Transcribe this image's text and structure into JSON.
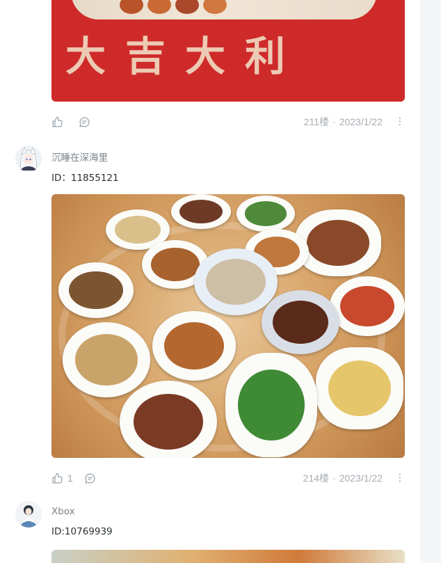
{
  "posts": [
    {
      "image_desc": "red-banner-photo",
      "image_slogan": "大吉大利",
      "like_count": "",
      "floor": "211楼",
      "date": "2023/1/22",
      "more": "⋮"
    },
    {
      "author": "沉睡在深海里",
      "author_id": "ID：11855121",
      "like_count": "1",
      "floor": "214楼",
      "date": "2023/1/22",
      "more": "⋮"
    },
    {
      "author": "Xbox",
      "author_id": "ID:10769939"
    }
  ],
  "meta_separator": "·",
  "colors": {
    "panel_bg": "#ffffff",
    "page_bg": "#f4f5f7",
    "muted_text": "#a7adb4",
    "icon": "#9aa3ad",
    "author_name": "#7a828b",
    "id_text": "#2b2f33"
  },
  "icons": [
    "thumbs-up-icon",
    "comment-icon",
    "more-vertical-icon"
  ]
}
